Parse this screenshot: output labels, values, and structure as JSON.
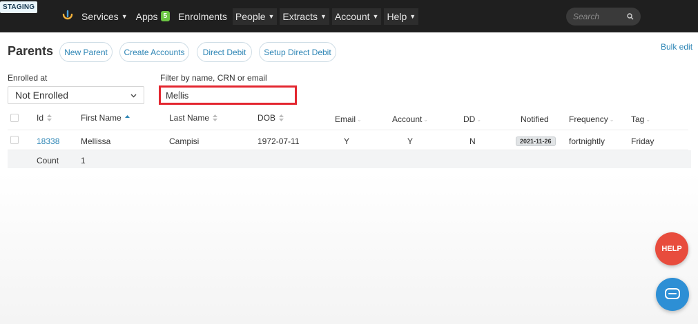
{
  "env_badge": "STAGING",
  "nav": {
    "items": [
      {
        "label": "Services",
        "has_caret": true
      },
      {
        "label": "Apps",
        "badge": "5"
      },
      {
        "label": "Enrolments"
      },
      {
        "label": "People",
        "has_caret": true
      },
      {
        "label": "Extracts",
        "has_caret": true
      },
      {
        "label": "Account",
        "has_caret": true
      },
      {
        "label": "Help",
        "has_caret": true
      }
    ],
    "search_placeholder": "Search"
  },
  "page": {
    "title": "Parents",
    "actions": [
      "New Parent",
      "Create Accounts",
      "Direct Debit",
      "Setup Direct Debit"
    ],
    "bulk_edit": "Bulk edit"
  },
  "filters": {
    "enrolled_label": "Enrolled at",
    "enrolled_value": "Not Enrolled",
    "filter_label": "Filter by name, CRN or email",
    "filter_value_a": "Mell",
    "filter_value_b": "is"
  },
  "table": {
    "columns": [
      "Id",
      "First Name",
      "Last Name",
      "DOB",
      "Email",
      "Account",
      "DD",
      "Notified",
      "Frequency",
      "Tag"
    ],
    "rows": [
      {
        "id": "18338",
        "first_name": "Mellissa",
        "last_name": "Campisi",
        "dob": "1972-07-11",
        "email": "Y",
        "account": "Y",
        "dd": "N",
        "notified": "2021-11-26",
        "frequency": "fortnightly",
        "tag": "Friday"
      }
    ],
    "count_label": "Count",
    "count_value": "1"
  },
  "floating": {
    "help_label": "HELP"
  },
  "colors": {
    "nav_bg": "#1f1f1f",
    "accent_link": "#2d85b5",
    "highlight_red": "#e3262f",
    "help_red": "#e84c3d",
    "chat_blue": "#2d8fd5",
    "badge_green": "#6cc644"
  }
}
